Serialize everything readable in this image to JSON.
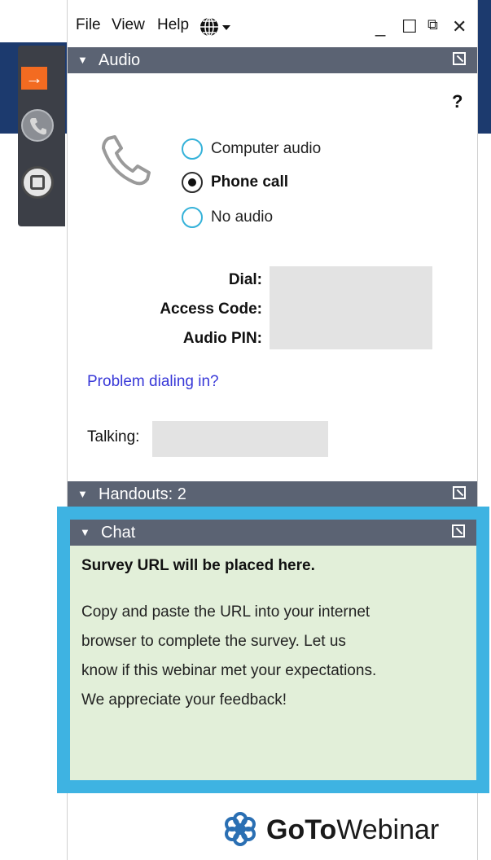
{
  "menu": {
    "file": "File",
    "view": "View",
    "help": "Help"
  },
  "window_controls": {
    "minimize": "_",
    "maximize": "☐",
    "popout": "⧉",
    "close": "✕"
  },
  "sections": {
    "audio": "Audio",
    "handouts": "Handouts: 2",
    "chat": "Chat"
  },
  "audio": {
    "help": "?",
    "options": [
      {
        "label": "Computer audio",
        "selected": false
      },
      {
        "label": "Phone call",
        "selected": true
      },
      {
        "label": "No audio",
        "selected": false
      }
    ],
    "dial_label": "Dial:",
    "access_code_label": "Access Code:",
    "audio_pin_label": "Audio PIN:",
    "problem_link": "Problem dialing in?",
    "talking_label": "Talking:"
  },
  "chat": {
    "heading": "Survey URL will be placed here.",
    "lines": [
      "Copy and paste the URL into your internet",
      "browser to complete the survey. Let us",
      "know if this webinar met your expectations.",
      "We appreciate your feedback!"
    ]
  },
  "logo": {
    "bold": "GoTo",
    "regular": "Webinar"
  },
  "colors": {
    "banner": "#1c3a6e",
    "section_bar": "#5b6373",
    "chat_frame": "#3eb3e2",
    "chat_bg": "#e2efd9",
    "link": "#3838d8",
    "arrow_tab": "#f36b21"
  },
  "icons": [
    "arrow-right-icon",
    "phone-icon",
    "screen-icon",
    "globe-icon",
    "popout-icon",
    "flower-logo-icon"
  ]
}
